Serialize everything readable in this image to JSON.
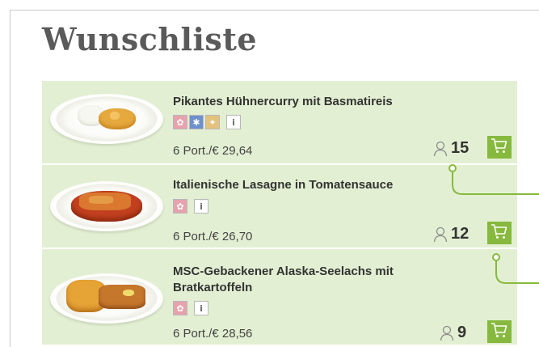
{
  "page_title": "Wunschliste",
  "items": [
    {
      "name": "Pikantes Hühnercurry mit Basmatireis",
      "badges": [
        "pork-free-icon",
        "dairy-icon",
        "grain-icon"
      ],
      "info_label": "i",
      "price": "6 Port./€ 29,64",
      "persons": "15"
    },
    {
      "name": "Italienische Lasagne in Tomatensauce",
      "badges": [
        "pork-free-icon"
      ],
      "info_label": "i",
      "price": "6 Port./€ 26,70",
      "persons": "12"
    },
    {
      "name": "MSC-Gebackener Alaska-Seelachs mit Bratkartoffeln",
      "badges": [
        "pork-free-icon"
      ],
      "info_label": "i",
      "price": "6 Port./€ 28,56",
      "persons": "9"
    }
  ],
  "colors": {
    "row_background": "#e3efd2",
    "accent_green": "#86b93d",
    "title_gray": "#5a5a5a"
  }
}
